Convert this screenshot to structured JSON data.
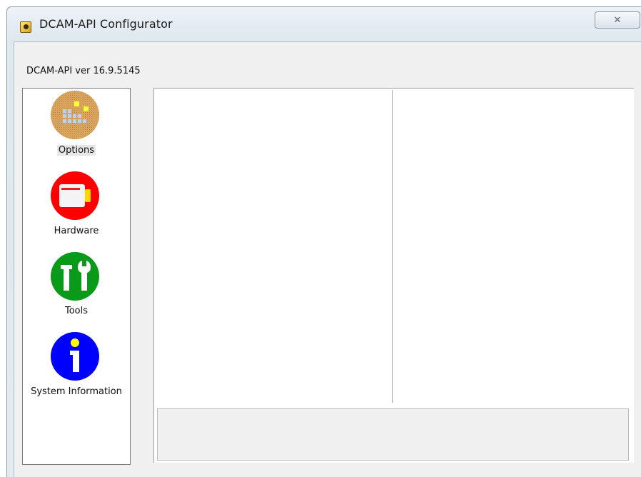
{
  "window": {
    "title": "DCAM-API Configurator",
    "close_glyph": "✕",
    "icon": "app-icon"
  },
  "header": {
    "version_text": "DCAM-API ver 16.9.5145"
  },
  "sidebar": {
    "items": [
      {
        "label": "Options",
        "icon": "options-icon",
        "color": "#d9a15a",
        "selected": true
      },
      {
        "label": "Hardware",
        "icon": "hardware-icon",
        "color": "#ff0000",
        "selected": false
      },
      {
        "label": "Tools",
        "icon": "tools-icon",
        "color": "#0a9a1a",
        "selected": false
      },
      {
        "label": "System Information",
        "icon": "info-icon",
        "color": "#0000ff",
        "selected": false
      }
    ]
  },
  "main": {
    "left_pane": "",
    "right_pane": "",
    "status_text": ""
  }
}
